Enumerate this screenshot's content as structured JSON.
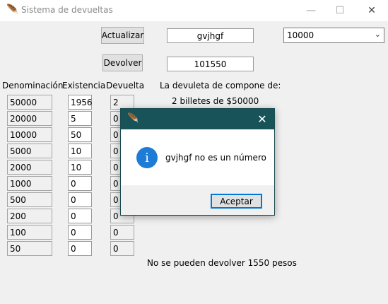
{
  "window": {
    "title": "Sistema de devueltas",
    "minimize_glyph": "—",
    "maximize_glyph": "☐",
    "close_glyph": "✕",
    "feather_glyph": "🪶"
  },
  "controls": {
    "update_label": "Actualizar",
    "return_label": "Devolver",
    "text_input_value": "gvjhgf",
    "amount_value": "101550",
    "combo_value": "10000"
  },
  "table": {
    "headers": {
      "denomination": "Denominación",
      "stock": "Existencia",
      "returned": "Devuelta"
    },
    "rows": [
      {
        "denomination": "50000",
        "stock": "1956",
        "returned": "2"
      },
      {
        "denomination": "20000",
        "stock": "5",
        "returned": "0"
      },
      {
        "denomination": "10000",
        "stock": "50",
        "returned": "0"
      },
      {
        "denomination": "5000",
        "stock": "10",
        "returned": "0"
      },
      {
        "denomination": "2000",
        "stock": "10",
        "returned": "0"
      },
      {
        "denomination": "1000",
        "stock": "0",
        "returned": "0"
      },
      {
        "denomination": "500",
        "stock": "0",
        "returned": "0"
      },
      {
        "denomination": "200",
        "stock": "0",
        "returned": "0"
      },
      {
        "denomination": "100",
        "stock": "0",
        "returned": "0"
      },
      {
        "denomination": "50",
        "stock": "0",
        "returned": "0"
      }
    ]
  },
  "summary": {
    "heading": "La devuleta de compone de:",
    "line1": "2  billetes  de  $50000",
    "status": "No se pueden devolver 1550 pesos"
  },
  "dialog": {
    "message": "gvjhgf no es un número",
    "accept_label": "Aceptar",
    "info_glyph": "i",
    "close_glyph": "✕"
  }
}
